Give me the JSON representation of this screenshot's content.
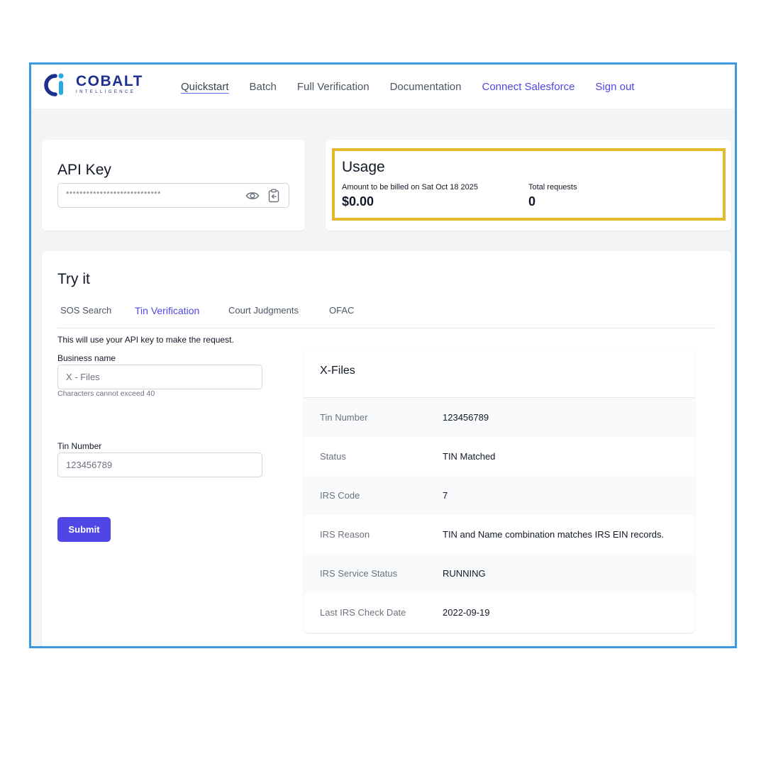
{
  "brand": {
    "name": "COBALT",
    "tagline": "INTELLIGENCE"
  },
  "nav": {
    "links": [
      {
        "label": "Quickstart",
        "active": true
      },
      {
        "label": "Batch"
      },
      {
        "label": "Full Verification"
      },
      {
        "label": "Documentation"
      },
      {
        "label": "Connect Salesforce",
        "accent": true
      },
      {
        "label": "Sign out",
        "accent": true
      }
    ]
  },
  "api_key": {
    "title": "API Key",
    "masked_value": "****************************",
    "icons": [
      "eye-icon",
      "clipboard-icon"
    ]
  },
  "usage": {
    "title": "Usage",
    "billing_label": "Amount to be billed on Sat Oct 18 2025",
    "billing_amount": "$0.00",
    "requests_label": "Total requests",
    "requests_count": "0",
    "highlight_color": "#e2b928"
  },
  "try_it": {
    "title": "Try it",
    "tabs": [
      "SOS Search",
      "Tin Verification",
      "Court Judgments",
      "OFAC"
    ],
    "active_tab": "Tin Verification",
    "hint": "This will use your API key to make the request.",
    "business_name_label": "Business name",
    "business_name_value": "X - Files",
    "business_name_help": "Characters cannot exceed 40",
    "tin_label": "Tin Number",
    "tin_value": "123456789",
    "submit_label": "Submit"
  },
  "result": {
    "title": "X-Files",
    "rows": [
      {
        "label": "Tin Number",
        "value": "123456789"
      },
      {
        "label": "Status",
        "value": "TIN Matched"
      },
      {
        "label": "IRS Code",
        "value": "7"
      },
      {
        "label": "IRS Reason",
        "value": "TIN and Name combination matches IRS EIN records."
      },
      {
        "label": "IRS Service Status",
        "value": "RUNNING"
      },
      {
        "label": "Last IRS Check Date",
        "value": "2022-09-19"
      }
    ]
  },
  "colors": {
    "accent": "#4f46e5",
    "frame_border": "#3b9ae1",
    "brand": "#1e2f8f",
    "brand_cyan": "#2aa9e0"
  }
}
